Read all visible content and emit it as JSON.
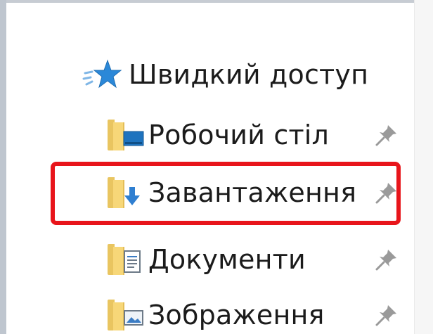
{
  "nav": {
    "quick_access": {
      "label": "Швидкий доступ",
      "icon": "star-icon"
    },
    "items": [
      {
        "label": "Робочий стіл",
        "icon": "desktop-folder-icon",
        "pinned": true
      },
      {
        "label": "Завантаження",
        "icon": "downloads-folder-icon",
        "pinned": true,
        "highlighted": true
      },
      {
        "label": "Документи",
        "icon": "documents-folder-icon",
        "pinned": true
      },
      {
        "label": "Зображення",
        "icon": "pictures-folder-icon",
        "pinned": true
      }
    ]
  },
  "colors": {
    "highlight": "#e8151b",
    "star": "#2b88d8",
    "folder": "#f7d778",
    "pin": "#9a9a9a"
  }
}
